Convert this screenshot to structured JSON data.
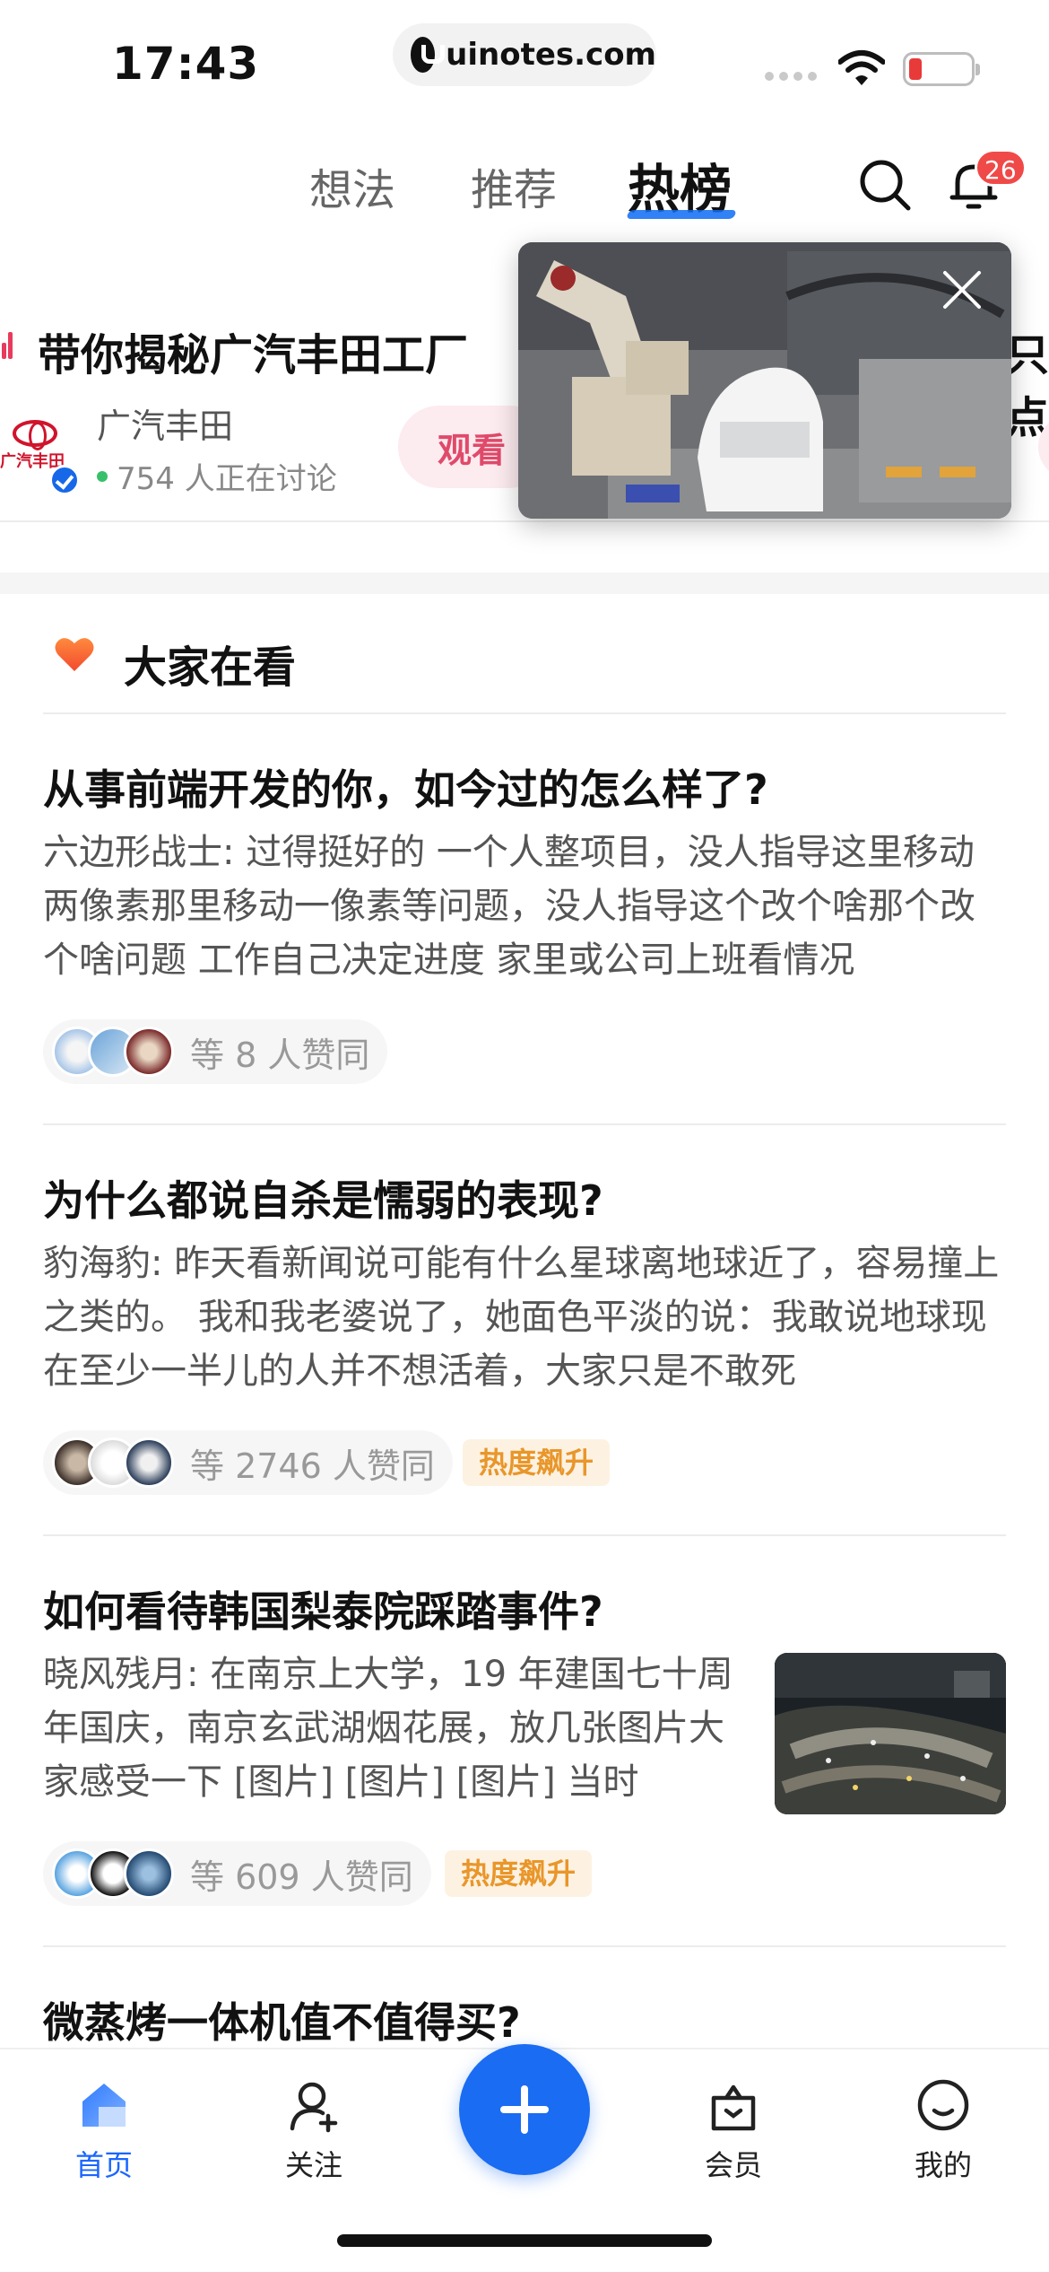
{
  "status_bar": {
    "time": "17:43",
    "url": "uinotes.com"
  },
  "top_nav": {
    "tabs": [
      "想法",
      "推荐",
      "热榜"
    ],
    "active_tab": "热榜",
    "notification_count": "26"
  },
  "live_banner": {
    "title": "带你揭秘广汽丰田工厂",
    "brand_name": "广汽丰田",
    "brand_logo_text": "广汽丰田",
    "discussing": "754 人正在讨论",
    "watch_label": "观看",
    "next_card_peek": "只点"
  },
  "section": {
    "title": "大家在看"
  },
  "feed": [
    {
      "title": "从事前端开发的你，如今过的怎么样了?",
      "excerpt": "六边形战士: 过得挺好的 一个人整项目，没人指导这里移动两像素那里移动一像素等问题，没人指导这个改个啥那个改个啥问题 工作自己决定进度 家里或公司上班看情况",
      "agree": "等 8 人赞同",
      "hot_tag": ""
    },
    {
      "title": "为什么都说自杀是懦弱的表现?",
      "excerpt": "豹海豹: 昨天看新闻说可能有什么星球离地球近了，容易撞上之类的。 我和我老婆说了，她面色平淡的说：我敢说地球现在至少一半儿的人并不想活着，大家只是不敢死",
      "agree": "等 2746 人赞同",
      "hot_tag": "热度飙升"
    },
    {
      "title": "如何看待韩国梨泰院踩踏事件?",
      "excerpt": "晓风残月: 在南京上大学，19 年建国七十周年国庆，南京玄武湖烟花展，放几张图片大家感受一下 [图片] [图片] [图片] 当时",
      "agree": "等 609 人赞同",
      "hot_tag": "热度飙升"
    },
    {
      "title": "微蒸烤一体机值不值得买?"
    }
  ],
  "tabbar": {
    "home": "首页",
    "follow": "关注",
    "vip": "会员",
    "me": "我的"
  },
  "colors": {
    "accent": "#1a6cf2",
    "live_red": "#e83b5c",
    "hot_orange": "#e9962a"
  }
}
